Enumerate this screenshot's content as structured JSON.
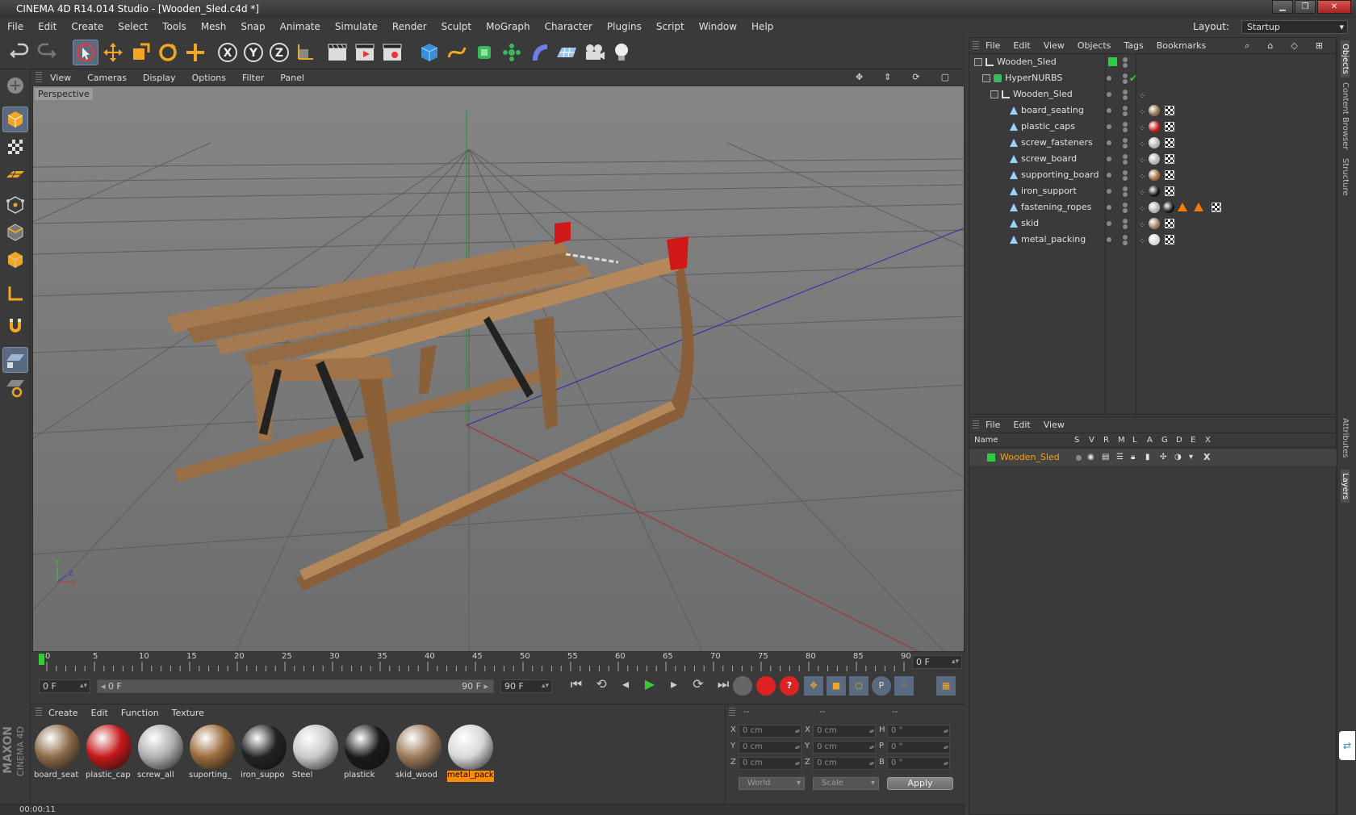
{
  "window": {
    "title": "CINEMA 4D R14.014 Studio - [Wooden_Sled.c4d *]",
    "layout_label": "Layout:",
    "layout_value": "Startup"
  },
  "menu": [
    "File",
    "Edit",
    "Create",
    "Select",
    "Tools",
    "Mesh",
    "Snap",
    "Animate",
    "Simulate",
    "Render",
    "Sculpt",
    "MoGraph",
    "Character",
    "Plugins",
    "Script",
    "Window",
    "Help"
  ],
  "toolbar": {
    "x_axis": "X",
    "y_axis": "Y",
    "z_axis": "Z"
  },
  "viewport": {
    "menu": [
      "View",
      "Cameras",
      "Display",
      "Options",
      "Filter",
      "Panel"
    ],
    "label": "Perspective",
    "axis_x": "X",
    "axis_y": "Y",
    "axis_z": "Z"
  },
  "timeline": {
    "ticks": [
      "0",
      "5",
      "10",
      "15",
      "20",
      "25",
      "30",
      "35",
      "40",
      "45",
      "50",
      "55",
      "60",
      "65",
      "70",
      "75",
      "80",
      "85",
      "90"
    ],
    "current_frame": "0 F"
  },
  "controls": {
    "start_frame": "0 F",
    "range_start": "0 F",
    "range_end": "90 F",
    "end_frame": "90 F"
  },
  "materials": {
    "menu": [
      "Create",
      "Edit",
      "Function",
      "Texture"
    ],
    "items": [
      {
        "label": "board_seat",
        "color": "#8a6a48"
      },
      {
        "label": "plastic_cap",
        "color": "#c41818"
      },
      {
        "label": "screw_all",
        "color": "#b0b0b0"
      },
      {
        "label": "suporting_",
        "color": "#9a6a3a"
      },
      {
        "label": "iron_suppo",
        "color": "#222222"
      },
      {
        "label": "Steel",
        "color": "#c8c8c8"
      },
      {
        "label": "plastick",
        "color": "#1a1a1a"
      },
      {
        "label": "skid_wood",
        "color": "#9a7a5a"
      },
      {
        "label": "metal_pack",
        "color": "#d8d8d8"
      }
    ]
  },
  "coords": {
    "headers": [
      "--",
      "--",
      "--"
    ],
    "rows": [
      {
        "l1": "X",
        "v1": "0 cm",
        "l2": "X",
        "v2": "0 cm",
        "l3": "H",
        "v3": "0 °"
      },
      {
        "l1": "Y",
        "v1": "0 cm",
        "l2": "Y",
        "v2": "0 cm",
        "l3": "P",
        "v3": "0 °"
      },
      {
        "l1": "Z",
        "v1": "0 cm",
        "l2": "Z",
        "v2": "0 cm",
        "l3": "B",
        "v3": "0 °"
      }
    ],
    "mode": "World",
    "type": "Scale",
    "apply": "Apply"
  },
  "status": {
    "time": "00:00:11"
  },
  "brand": {
    "maxon": "MAXON",
    "c4d": "CINEMA 4D"
  },
  "objects": {
    "menu": [
      "File",
      "Edit",
      "View",
      "Objects",
      "Tags",
      "Bookmarks"
    ],
    "items": [
      {
        "name": "Wooden_Sled",
        "indent": 0
      },
      {
        "name": "HyperNURBS",
        "indent": 1
      },
      {
        "name": "Wooden_Sled",
        "indent": 2
      },
      {
        "name": "board_seating",
        "indent": 3
      },
      {
        "name": "plastic_caps",
        "indent": 3
      },
      {
        "name": "screw_fasteners",
        "indent": 3
      },
      {
        "name": "screw_board",
        "indent": 3
      },
      {
        "name": "supporting_board",
        "indent": 3
      },
      {
        "name": "iron_support",
        "indent": 3
      },
      {
        "name": "fastening_ropes",
        "indent": 3
      },
      {
        "name": "skid",
        "indent": 3
      },
      {
        "name": "metal_packing",
        "indent": 3
      }
    ]
  },
  "layers": {
    "menu": [
      "File",
      "Edit",
      "View"
    ],
    "columns": [
      "Name",
      "S",
      "V",
      "R",
      "M",
      "L",
      "A",
      "G",
      "D",
      "E",
      "X"
    ],
    "items": [
      {
        "name": "Wooden_Sled",
        "color": "#2ecc40"
      }
    ]
  },
  "side_tabs": [
    "Objects",
    "Content Browser",
    "Structure",
    "Attributes",
    "Layers"
  ]
}
